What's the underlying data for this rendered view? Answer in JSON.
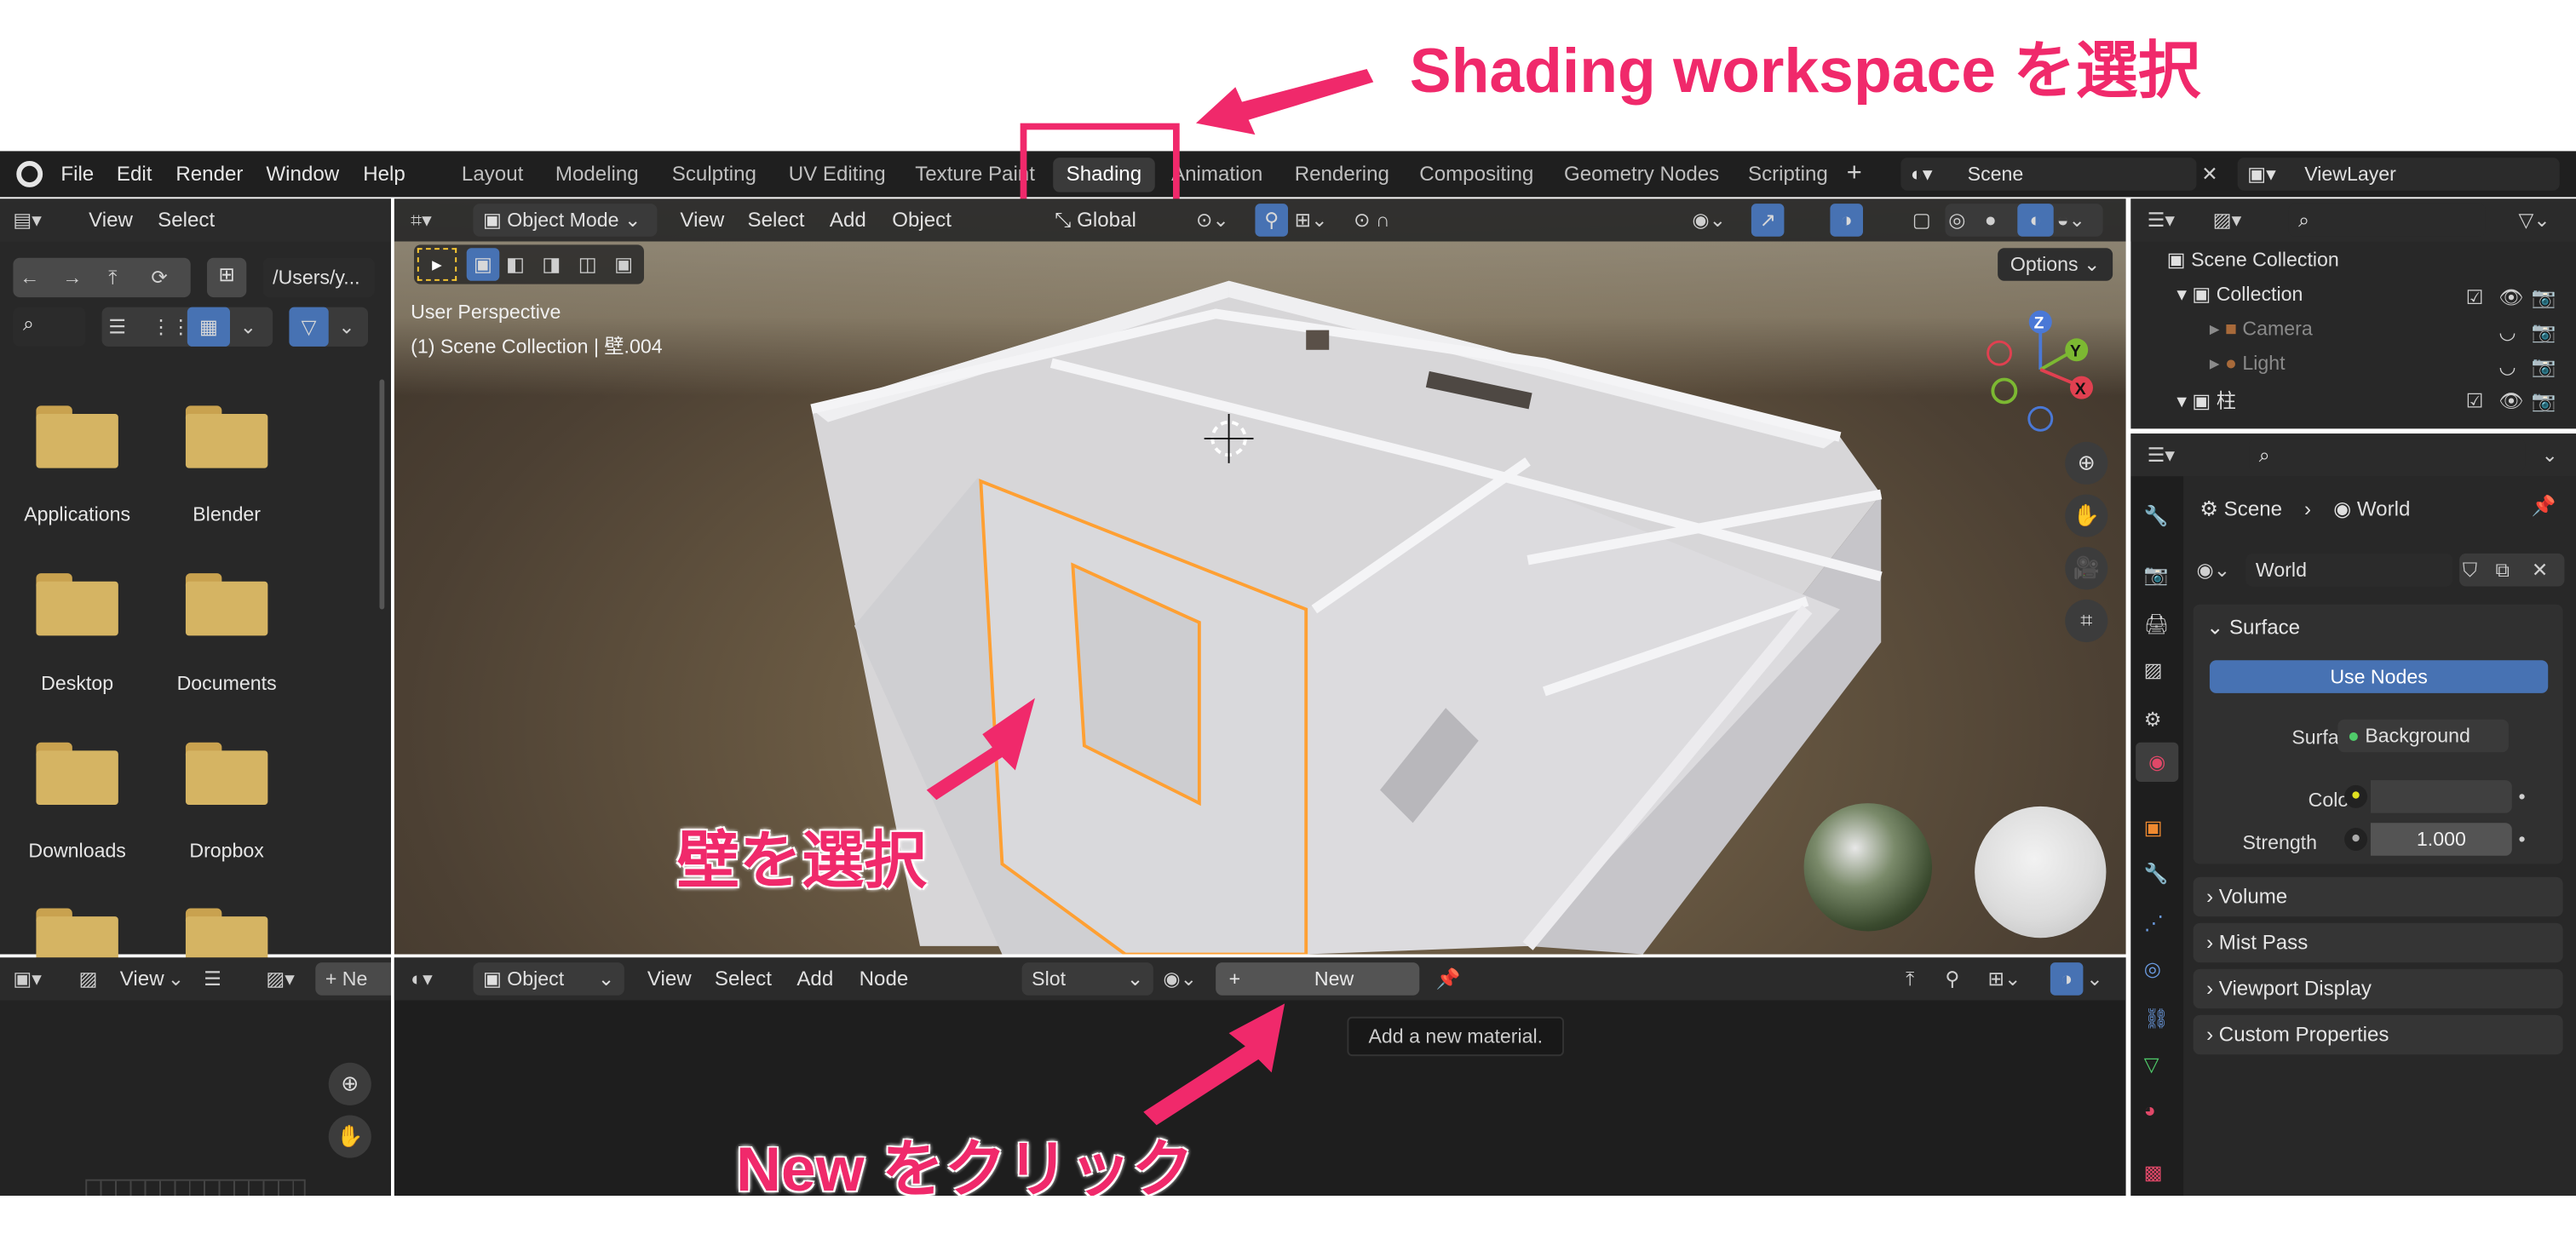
{
  "annotations": {
    "shading": "Shading workspace を選択",
    "wall": "壁を選択",
    "new": "New をクリック"
  },
  "menu": [
    "File",
    "Edit",
    "Render",
    "Window",
    "Help"
  ],
  "workspaces": [
    "Layout",
    "Modeling",
    "Sculpting",
    "UV Editing",
    "Texture Paint",
    "Shading",
    "Animation",
    "Rendering",
    "Compositing",
    "Geometry Nodes",
    "Scripting"
  ],
  "scene_name": "Scene",
  "view_layer": "ViewLayer",
  "file_browser": {
    "view": "View",
    "select": "Select",
    "path": "/Users/y...",
    "items": [
      "Applications",
      "Blender",
      "Desktop",
      "Documents",
      "Downloads",
      "Dropbox"
    ]
  },
  "viewport": {
    "mode": "Object Mode",
    "menus": [
      "View",
      "Select",
      "Add",
      "Object"
    ],
    "orientation": "Global",
    "options": "Options",
    "info_line1": "User Perspective",
    "info_line2": "(1) Scene Collection | 壁.004"
  },
  "node_editor": {
    "type": "Object",
    "menus": [
      "View",
      "Select",
      "Add",
      "Node"
    ],
    "slot": "Slot",
    "new": "New",
    "tooltip": "Add a new material."
  },
  "image_editor": {
    "view": "View",
    "new": "Ne"
  },
  "outliner": {
    "scene_collection": "Scene Collection",
    "collection": "Collection",
    "camera": "Camera",
    "light": "Light",
    "pillar": "柱"
  },
  "properties": {
    "scene": "Scene",
    "world": "World",
    "world_name": "World",
    "surface_panel": "Surface",
    "use_nodes": "Use Nodes",
    "surface_label": "Surface",
    "surface_value": "Background",
    "color_label": "Color",
    "strength_label": "Strength",
    "strength_value": "1.000",
    "panels": [
      "Volume",
      "Mist Pass",
      "Viewport Display",
      "Custom Properties"
    ]
  },
  "colors": {
    "accent": "#f0296b",
    "highlight_blue": "#4772b3",
    "selection_orange": "#ffa033"
  }
}
